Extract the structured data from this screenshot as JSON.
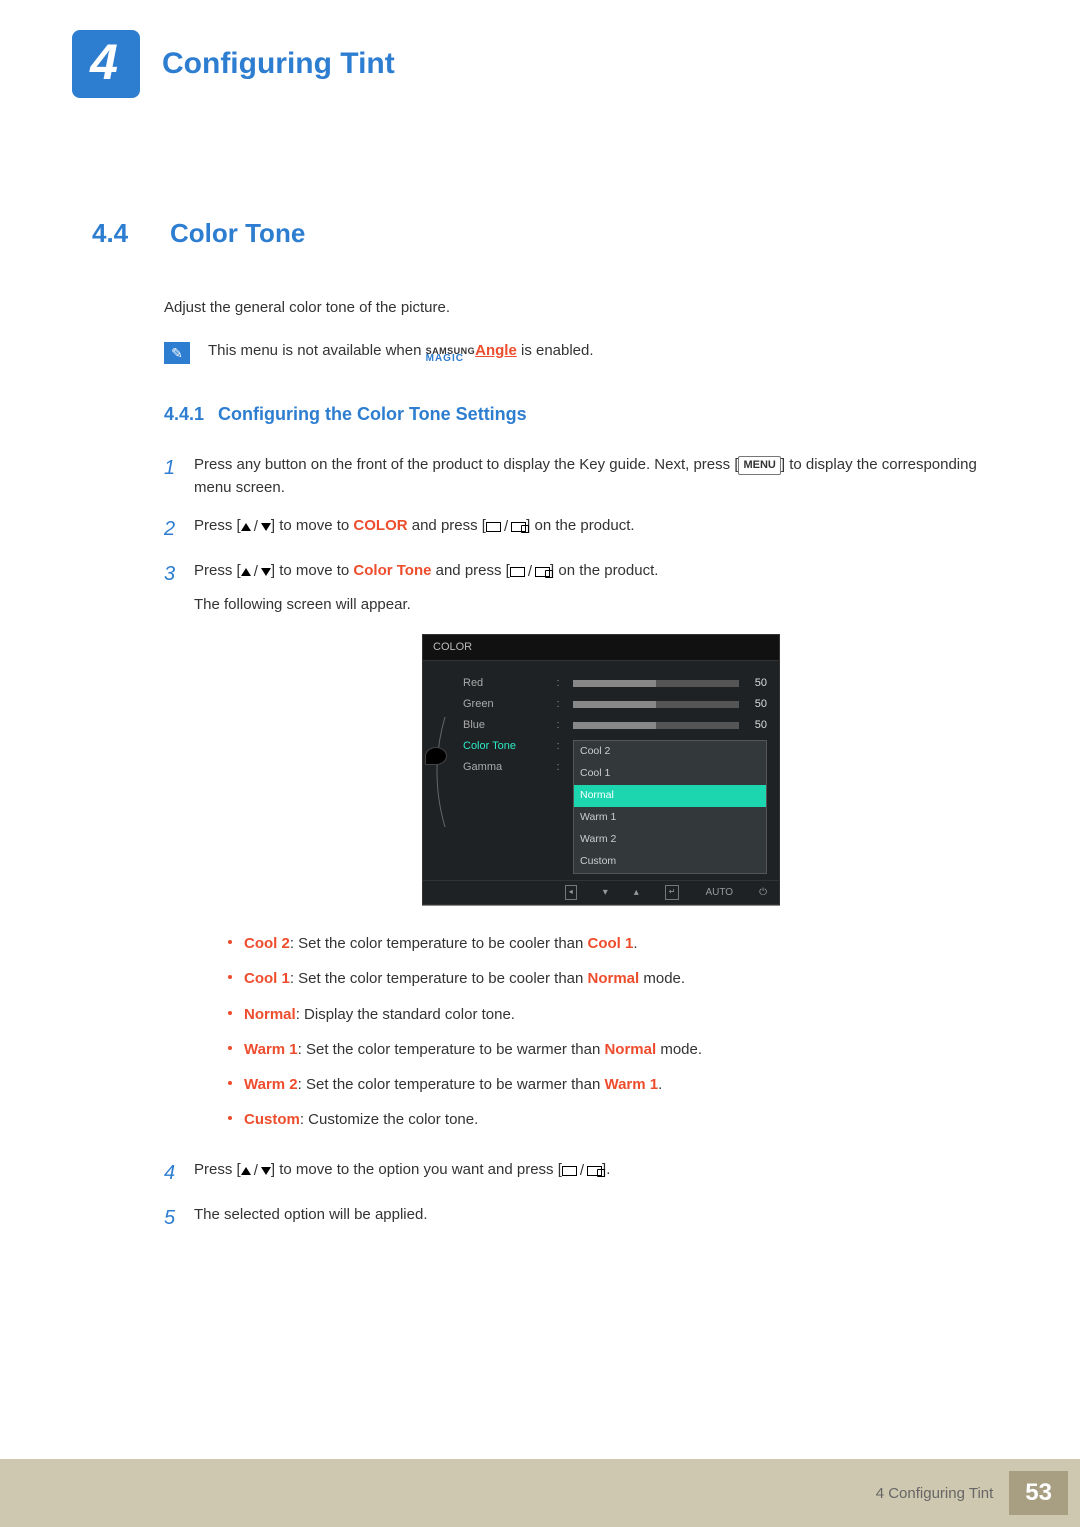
{
  "chapter": {
    "number": "4",
    "title": "Configuring Tint"
  },
  "section": {
    "number": "4.4",
    "title": "Color Tone"
  },
  "intro": "Adjust the general color tone of the picture.",
  "note": {
    "prefix": "This menu is not available when ",
    "samsung_top": "SAMSUNG",
    "samsung_bot": "MAGIC",
    "angle": "Angle",
    "suffix": " is enabled."
  },
  "subsection": {
    "number": "4.4.1",
    "title": "Configuring the Color Tone Settings"
  },
  "steps": {
    "1": {
      "pre": "Press any button on the front of the product to display the Key guide. Next, press [",
      "menu": "MENU",
      "post": "] to display the corresponding menu screen."
    },
    "2": {
      "pre": "Press [",
      "mid1": "] to move to ",
      "target": "COLOR",
      "mid2": " and press [",
      "post": "] on the product."
    },
    "3": {
      "pre": "Press [",
      "mid1": "] to move to ",
      "target": "Color Tone",
      "mid2": " and press [",
      "post": "] on the product.",
      "appear": "The following screen will appear."
    },
    "4": {
      "pre": "Press [",
      "mid": "] to move to the option you want and press [",
      "post": "]."
    },
    "5": "The selected option will be applied."
  },
  "osd": {
    "header": "COLOR",
    "rows": [
      {
        "label": "Red",
        "value": "50"
      },
      {
        "label": "Green",
        "value": "50"
      },
      {
        "label": "Blue",
        "value": "50"
      }
    ],
    "color_tone_label": "Color Tone",
    "gamma_label": "Gamma",
    "options": [
      "Cool 2",
      "Cool 1",
      "Normal",
      "Warm 1",
      "Warm 2",
      "Custom"
    ],
    "selected": "Normal",
    "auto": "AUTO"
  },
  "bullets": [
    {
      "term": "Cool 2",
      "text_pre": ": Set the color temperature to be cooler than ",
      "ref": "Cool 1",
      "text_post": "."
    },
    {
      "term": "Cool 1",
      "text_pre": ": Set the color temperature to be cooler than ",
      "ref": "Normal",
      "text_post": " mode."
    },
    {
      "term": "Normal",
      "text_pre": ": Display the standard color tone.",
      "ref": "",
      "text_post": ""
    },
    {
      "term": "Warm 1",
      "text_pre": ": Set the color temperature to be warmer than ",
      "ref": "Normal",
      "text_post": " mode."
    },
    {
      "term": "Warm 2",
      "text_pre": ": Set the color temperature to be warmer than ",
      "ref": "Warm 1",
      "text_post": "."
    },
    {
      "term": "Custom",
      "text_pre": ": Customize the color tone.",
      "ref": "",
      "text_post": ""
    }
  ],
  "footer": {
    "section_ref": "4 Configuring Tint",
    "page": "53"
  }
}
